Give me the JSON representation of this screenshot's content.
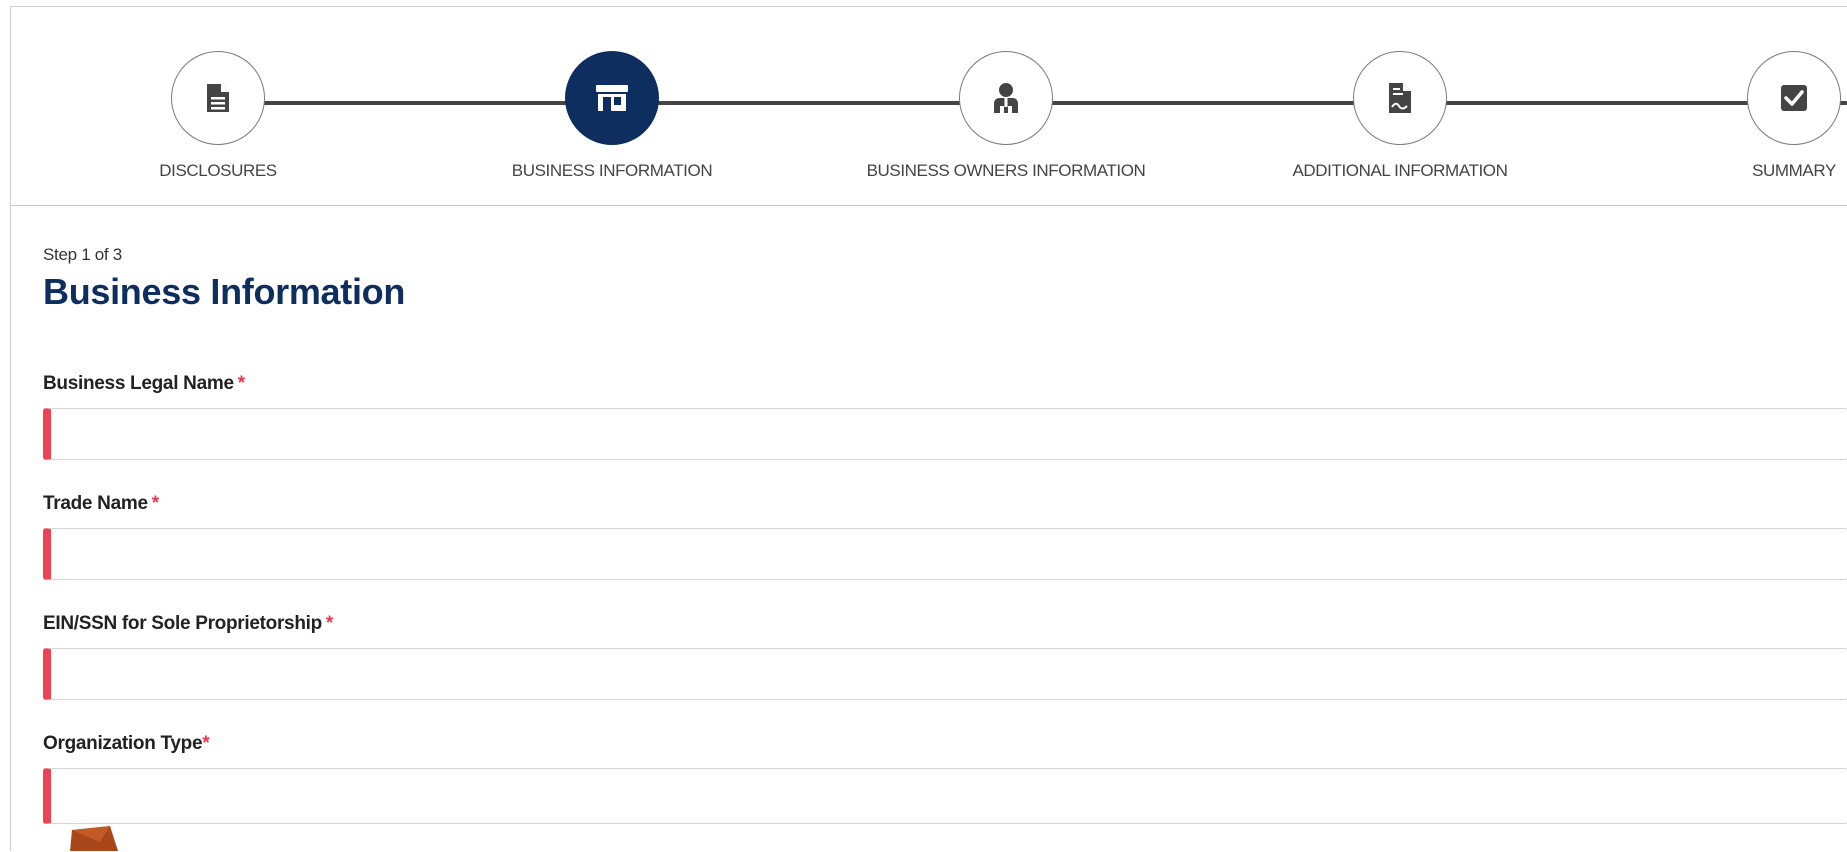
{
  "stepper": {
    "steps": [
      {
        "label": "DISCLOSURES",
        "icon": "document-icon",
        "active": false
      },
      {
        "label": "BUSINESS INFORMATION",
        "icon": "storefront-icon",
        "active": true
      },
      {
        "label": "BUSINESS OWNERS INFORMATION",
        "icon": "person-icon",
        "active": false
      },
      {
        "label": "ADDITIONAL INFORMATION",
        "icon": "signed-document-icon",
        "active": false
      },
      {
        "label": "SUMMARY",
        "icon": "checkbox-icon",
        "active": false
      }
    ]
  },
  "form": {
    "step_counter": "Step 1 of 3",
    "title": "Business Information",
    "required_marker": "*",
    "fields": [
      {
        "label": "Business Legal Name",
        "value": ""
      },
      {
        "label": "Trade Name",
        "value": ""
      },
      {
        "label": "EIN/SSN for Sole Proprietorship",
        "value": ""
      },
      {
        "label": "Organization Type",
        "value": ""
      }
    ]
  },
  "colors": {
    "primary": "#0d2e5f",
    "required": "#ee4255",
    "step_line": "#444444",
    "annotation_arrow": "#a9461a"
  }
}
